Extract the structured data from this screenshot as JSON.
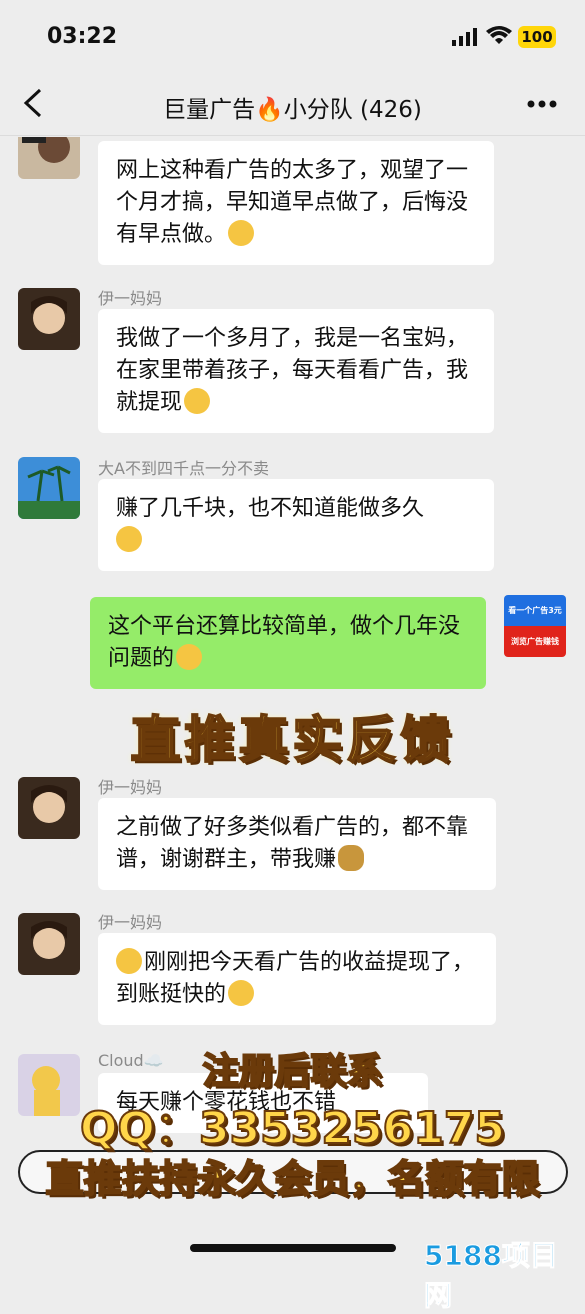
{
  "status": {
    "time": "03:22",
    "battery": "100"
  },
  "nav": {
    "title": "巨量广告🔥小分队 (426)"
  },
  "messages": [
    {
      "sender": "",
      "text": "网上这种看广告的太多了，观望了一个月才搞，早知道早点做了，后悔没有早点做。",
      "emoji": "sweat-smile-emoji"
    },
    {
      "sender": "伊一妈妈",
      "text": "我做了一个多月了，我是一名宝妈，在家里带着孩子，每天看看广告，我就提现",
      "emoji": "thinking-emoji"
    },
    {
      "sender": "大A不到四千点一分不卖",
      "text": "赚了几千块，也不知道能做多久",
      "emoji": "grin-emoji"
    },
    {
      "sender": "",
      "text": "这个平台还算比较简单，做个几年没问题的",
      "emoji": "victory-hand-emoji"
    },
    {
      "sender": "伊一妈妈",
      "text": "之前做了好多类似看广告的，都不靠谱，谢谢群主，带我赚",
      "emoji": "money-bag-emoji"
    },
    {
      "sender": "伊一妈妈",
      "text": "刚刚把今天看广告的收益提现了，到账挺快的",
      "emoji": "grin-emoji"
    },
    {
      "sender": "Cloud☁️",
      "text": "每天赚个零花钱也不错",
      "emoji": ""
    }
  ],
  "ad_thumb": {
    "line1": "看一个广告3元",
    "line2": "浏览广告赚钱"
  },
  "overlay": {
    "headline": "直推真实反馈",
    "promo1": "注册后联系",
    "promo2": "QQ：3353256175",
    "promo3": "直推扶持永久会员，名额有限"
  },
  "watermark": "5188项目网",
  "colors": {
    "my_bubble": "#95ec69",
    "other_bubble": "#ffffff",
    "background": "#ededed"
  }
}
